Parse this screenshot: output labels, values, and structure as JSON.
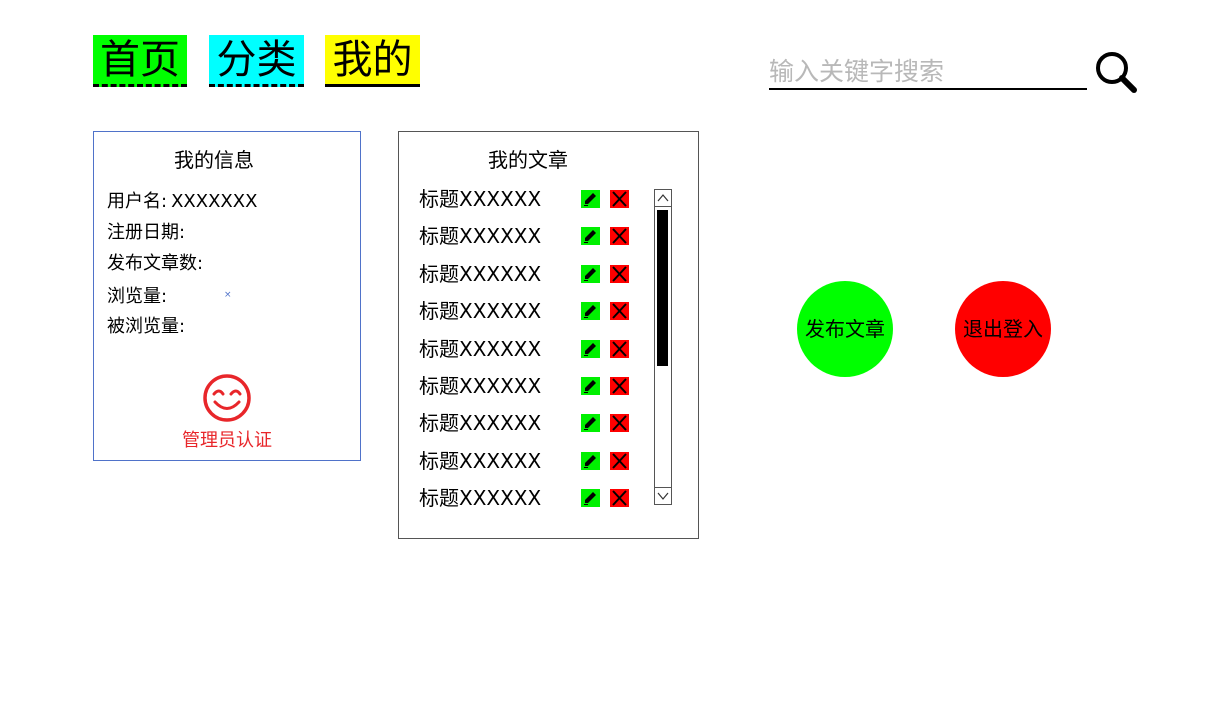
{
  "nav": {
    "tabs": [
      {
        "label": "首页",
        "color": "#00ff00"
      },
      {
        "label": "分类",
        "color": "#00ffff"
      },
      {
        "label": "我的",
        "color": "#ffff00"
      }
    ]
  },
  "search": {
    "placeholder": "输入关键字搜索",
    "icon": "magnifier-icon"
  },
  "info_panel": {
    "title": "我的信息",
    "fields": [
      {
        "label": "用户名:",
        "value": "XXXXXXX"
      },
      {
        "label": "注册日期:",
        "value": ""
      },
      {
        "label": "发布文章数:",
        "value": ""
      },
      {
        "label": "浏览量:",
        "value": ""
      },
      {
        "label": "被浏览量:",
        "value": ""
      }
    ],
    "tiny_mark": "×",
    "badge_icon": "smile-icon",
    "badge_label": "管理员认证",
    "badge_color": "#e8262a"
  },
  "articles_panel": {
    "title": "我的文章",
    "items": [
      {
        "title": "标题XXXXXX"
      },
      {
        "title": "标题XXXXXX"
      },
      {
        "title": "标题XXXXXX"
      },
      {
        "title": "标题XXXXXX"
      },
      {
        "title": "标题XXXXXX"
      },
      {
        "title": "标题XXXXXX"
      },
      {
        "title": "标题XXXXXX"
      },
      {
        "title": "标题XXXXXX"
      },
      {
        "title": "标题XXXXXX"
      }
    ],
    "edit_icon": "pencil-icon",
    "delete_icon": "close-icon",
    "edit_color": "#00f000",
    "delete_color": "#ff0000"
  },
  "actions": {
    "publish_label": "发布文章",
    "publish_color": "#00ff00",
    "logout_label": "退出登入",
    "logout_color": "#ff0000"
  }
}
